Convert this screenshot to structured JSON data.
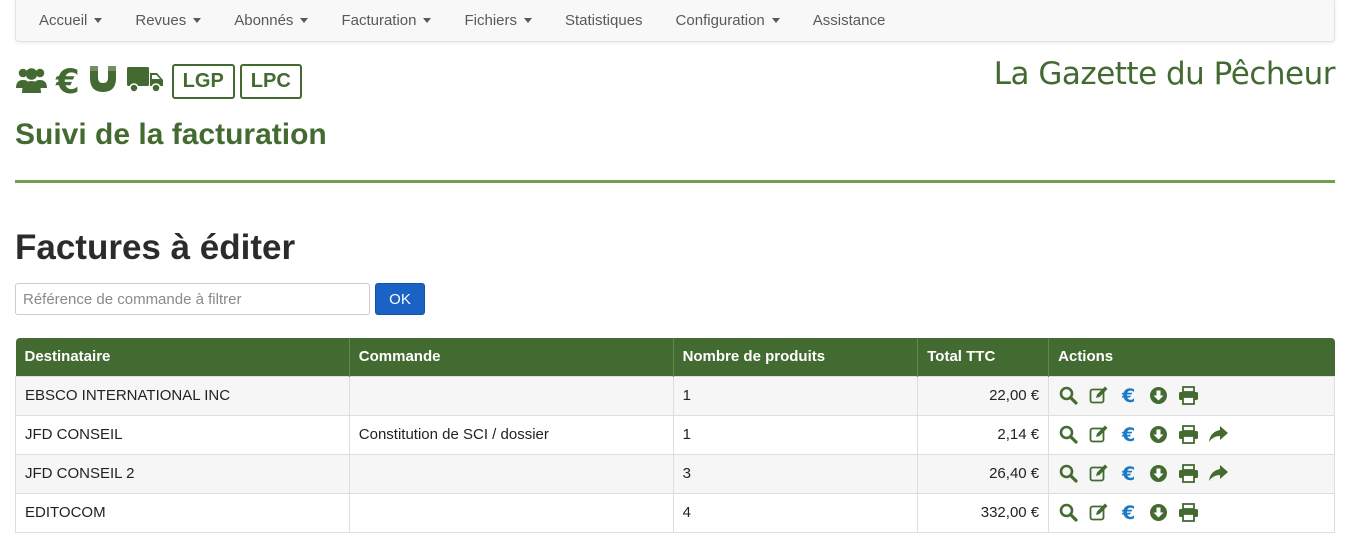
{
  "nav": {
    "items": [
      {
        "label": "Accueil",
        "dropdown": true
      },
      {
        "label": "Revues",
        "dropdown": true
      },
      {
        "label": "Abonnés",
        "dropdown": true
      },
      {
        "label": "Facturation",
        "dropdown": true
      },
      {
        "label": "Fichiers",
        "dropdown": true
      },
      {
        "label": "Statistiques",
        "dropdown": false
      },
      {
        "label": "Configuration",
        "dropdown": true
      },
      {
        "label": "Assistance",
        "dropdown": false
      }
    ]
  },
  "header": {
    "icons": [
      "users-icon",
      "euro-icon",
      "magnet-icon",
      "truck-icon"
    ],
    "euro_glyph": "€",
    "badges": [
      "LGP",
      "LPC"
    ],
    "site_title": "La Gazette du Pêcheur",
    "page_subtitle": "Suivi de la facturation"
  },
  "section": {
    "title": "Factures à éditer"
  },
  "filter": {
    "placeholder": "Référence de commande à filtrer",
    "value": "",
    "ok_label": "OK"
  },
  "table": {
    "columns": [
      "Destinataire",
      "Commande",
      "Nombre de produits",
      "Total TTC",
      "Actions"
    ],
    "rows": [
      {
        "destinataire": "EBSCO INTERNATIONAL INC",
        "commande": "",
        "nombre": "1",
        "total": "22,00 €",
        "forward": false
      },
      {
        "destinataire": "JFD CONSEIL",
        "commande": "Constitution de SCI / dossier",
        "nombre": "1",
        "total": "2,14 €",
        "forward": true
      },
      {
        "destinataire": "JFD CONSEIL 2",
        "commande": "",
        "nombre": "3",
        "total": "26,40 €",
        "forward": true
      },
      {
        "destinataire": "EDITOCOM",
        "commande": "",
        "nombre": "4",
        "total": "332,00 €",
        "forward": false
      }
    ],
    "action_icons": [
      "search-icon",
      "edit-icon",
      "euro-icon",
      "download-icon",
      "print-icon",
      "forward-icon"
    ],
    "action_euro_glyph": "€"
  },
  "colors": {
    "brand_green": "#436b31",
    "divider_green": "#6ea14f",
    "button_blue": "#1a62c4",
    "euro_blue": "#1a7ac4"
  }
}
